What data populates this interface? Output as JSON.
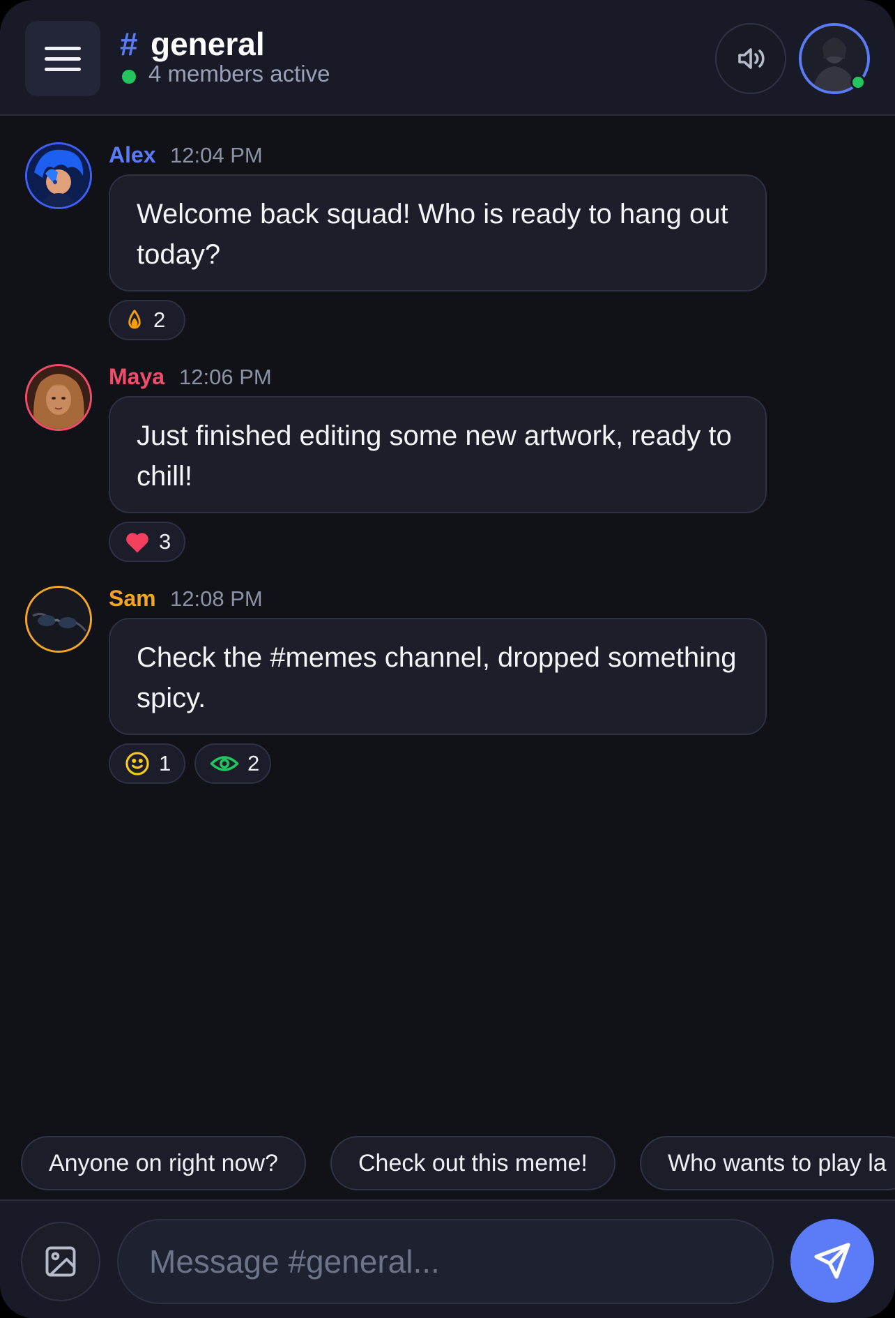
{
  "header": {
    "hash": "#",
    "channel": "general",
    "status": "4 members active",
    "icons": {
      "menu": "hamburger-menu-icon",
      "sound": "speaker-volume-icon",
      "status_color": "#22c55e"
    }
  },
  "messages": [
    {
      "author": "Alex",
      "author_color": "#5b7cf6",
      "time": "12:04 PM",
      "text": "Welcome back squad! Who is ready to hang out today?",
      "reactions": [
        {
          "icon": "flame-icon",
          "count": "2"
        }
      ]
    },
    {
      "author": "Maya",
      "author_color": "#f04d6c",
      "time": "12:06 PM",
      "text": "Just finished editing some new artwork, ready to chill!",
      "reactions": [
        {
          "icon": "heart-icon",
          "count": "3"
        }
      ]
    },
    {
      "author": "Sam",
      "author_color": "#f5a524",
      "time": "12:08 PM",
      "text": "Check the #memes channel, dropped something spicy.",
      "reactions": [
        {
          "icon": "smile-icon",
          "count": "1"
        },
        {
          "icon": "eye-icon",
          "count": "2"
        }
      ]
    }
  ],
  "quick_replies": [
    "Anyone on right now?",
    "Check out this meme!",
    "Who wants to play la"
  ],
  "composer": {
    "placeholder": "Message #general...",
    "accent": "#5b7cf6",
    "icons": {
      "attach": "image-icon",
      "send": "send-icon"
    }
  }
}
